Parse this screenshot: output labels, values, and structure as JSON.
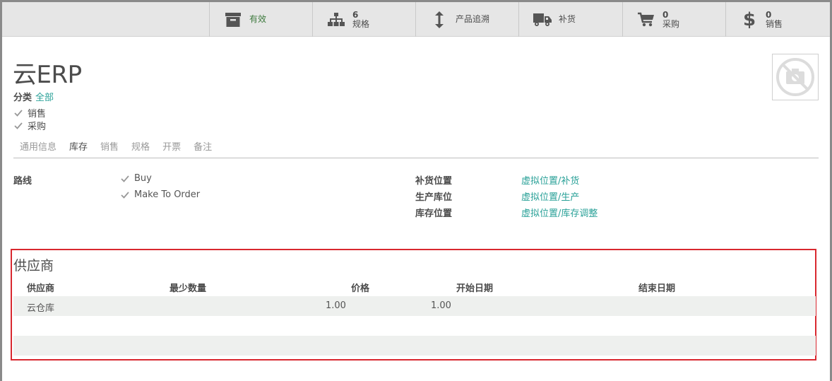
{
  "stat_buttons": [
    {
      "icon": "archive-box-icon",
      "number": "",
      "label": "有效"
    },
    {
      "icon": "sitemap-icon",
      "number": "6",
      "label": "规格"
    },
    {
      "icon": "vertical-arrows-icon",
      "number": "",
      "label": "产品追溯"
    },
    {
      "icon": "truck-icon",
      "number": "",
      "label": "补货"
    },
    {
      "icon": "cart-icon",
      "number": "0",
      "label": "采购"
    },
    {
      "icon": "dollar-icon",
      "number": "0",
      "label": "销售"
    }
  ],
  "product": {
    "name": "云ERP",
    "category_label": "分类",
    "category_value": "全部",
    "checkboxes": [
      {
        "label": "销售",
        "checked": true
      },
      {
        "label": "采购",
        "checked": true
      }
    ]
  },
  "tabs": [
    "通用信息",
    "库存",
    "销售",
    "规格",
    "开票",
    "备注"
  ],
  "active_tab": "库存",
  "inventory": {
    "routes_label": "路线",
    "routes": [
      {
        "label": "Buy",
        "checked": true
      },
      {
        "label": "Make To Order",
        "checked": true
      }
    ],
    "locations": [
      {
        "label": "补货位置",
        "value": "虚拟位置/补货"
      },
      {
        "label": "生产库位",
        "value": "虚拟位置/生产"
      },
      {
        "label": "库存位置",
        "value": "虚拟位置/库存调整"
      }
    ]
  },
  "suppliers": {
    "title": "供应商",
    "columns": [
      "供应商",
      "最少数量",
      "价格",
      "开始日期",
      "结束日期"
    ],
    "rows": [
      {
        "supplier": "云仓库",
        "min_qty": "1.00",
        "price": "1.00",
        "start": "",
        "end": ""
      }
    ]
  },
  "colors": {
    "accent": "#2aa198",
    "highlight_border": "#d9282f",
    "status_green": "#3d7a3d"
  }
}
